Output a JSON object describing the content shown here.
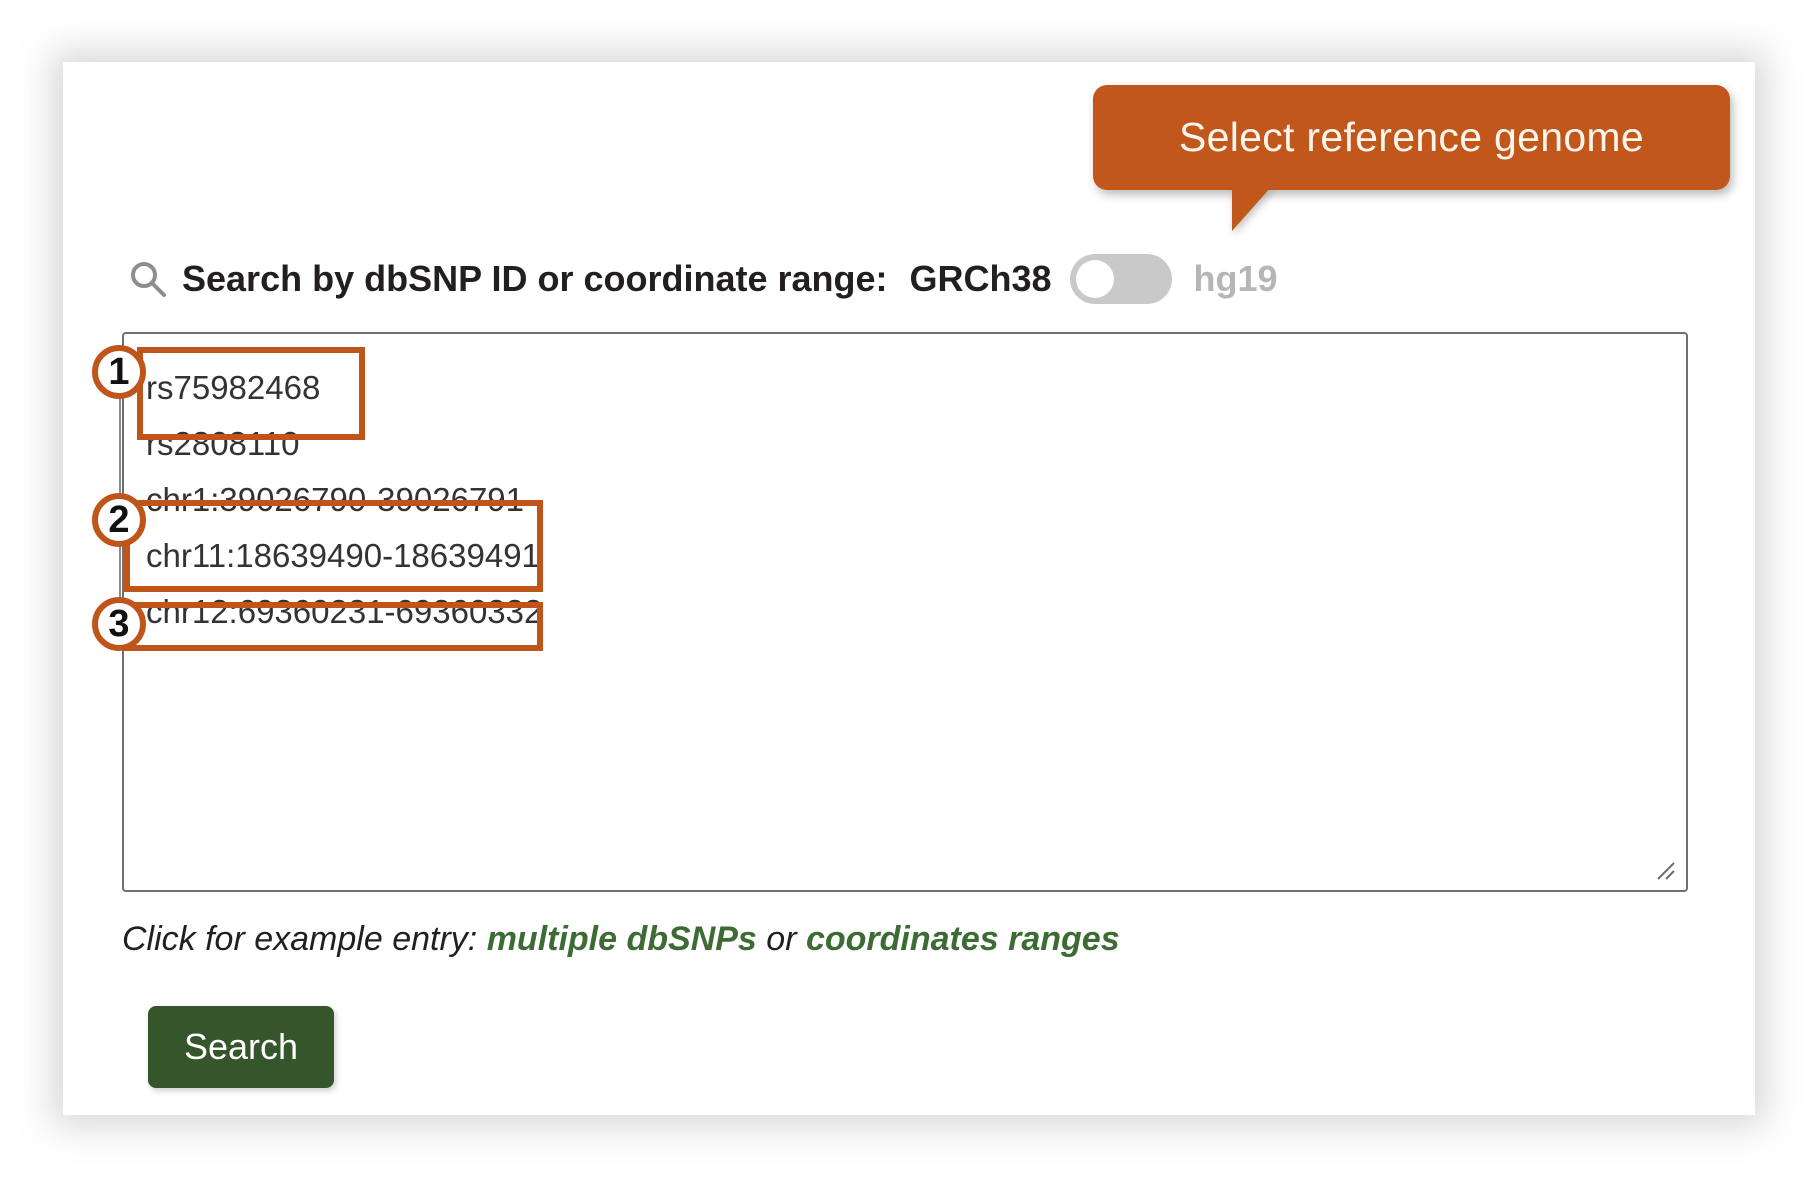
{
  "callout": {
    "text": "Select reference genome",
    "bg_color": "#c2571b",
    "text_color": "#fdf6ee"
  },
  "search_header": {
    "icon": "search-icon",
    "label": "Search by dbSNP ID or coordinate range:",
    "genome_active": "GRCh38",
    "genome_inactive": "hg19",
    "toggle_state": "left",
    "active_color": "#231f20",
    "inactive_color": "#b6b6b6"
  },
  "query": {
    "value": "rs75982468\nrs2808110\nchr1:39026790-39026791\nchr11:18639490-18639491\nchr12:69360231-69360332",
    "placeholder": "",
    "lines": [
      "rs75982468",
      "rs2808110",
      "chr1:39026790-39026791",
      "chr11:18639490-18639491",
      "chr12:69360231-69360332"
    ]
  },
  "annotations": {
    "accent_color": "#c0551a",
    "items": [
      {
        "number": "1",
        "covers": "rs75982468 / rs2808110"
      },
      {
        "number": "2",
        "covers": "chr1:39026790-39026791 / chr11:18639490-18639491"
      },
      {
        "number": "3",
        "covers": "chr12:69360231-69360332"
      }
    ]
  },
  "example": {
    "prefix": "Click for example entry:",
    "link_one": "multiple dbSNPs",
    "separator": "or",
    "link_two": "coordinates ranges",
    "link_color": "#3c6b34"
  },
  "actions": {
    "search_label": "Search",
    "search_bg": "#35562b"
  }
}
